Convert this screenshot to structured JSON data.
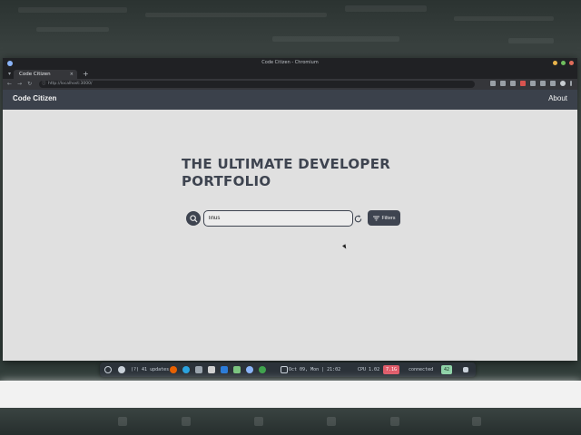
{
  "window": {
    "title": "Code Citizen - Chromium",
    "tab_title": "Code Citizen",
    "tab_close": "×",
    "new_tab": "+",
    "url": "http://localhost:3000/"
  },
  "app": {
    "brand": "Code Citizen",
    "nav_about": "About",
    "hero_title": "THE ULTIMATE DEVELOPER PORTFOLIO",
    "search": {
      "value": "linus",
      "placeholder": ""
    },
    "filters_label": "Filters"
  },
  "taskbar": {
    "updates": "(?) 41 updates",
    "datetime": "Oct 09, Mon | 21:02",
    "cpu": "CPU 1.02",
    "mem": "7.1G",
    "network": "connected",
    "volume": "42"
  },
  "colors": {
    "header_bg": "#3b414b",
    "accent_dark": "#3e4450",
    "page_bg": "#e0e0e0"
  },
  "icons": {
    "search": "magnifier-icon",
    "reset": "refresh-icon",
    "filters": "filter-lines-icon"
  }
}
